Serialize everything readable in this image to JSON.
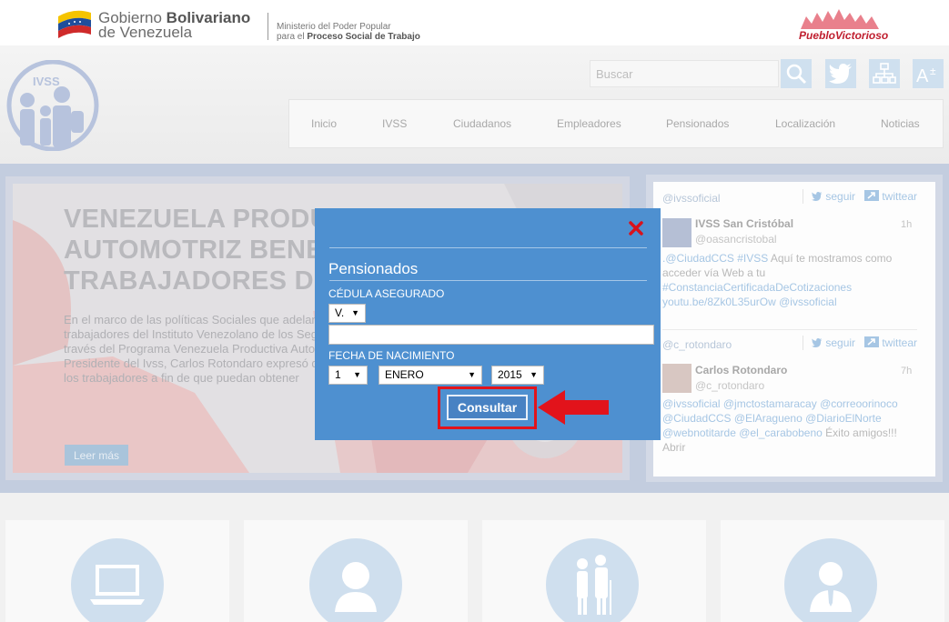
{
  "gov_bar": {
    "gov_name_line1_regular": "Gobierno ",
    "gov_name_line1_bold": "Bolivariano",
    "gov_name_line2": "de Venezuela",
    "ministry_line1": "Ministerio del Poder Popular",
    "ministry_line2_regular": "para el ",
    "ministry_line2_bold": "Proceso Social de Trabajo",
    "pueblo_logo_text": "PuebloVictorioso"
  },
  "header": {
    "search_placeholder": "Buscar",
    "nav": [
      "Inicio",
      "IVSS",
      "Ciudadanos",
      "Empleadores",
      "Pensionados",
      "Localización",
      "Noticias"
    ]
  },
  "slide": {
    "title_lines": [
      "VENEZUELA PRODUCTIVA",
      "AUTOMOTRIZ BENEFICIA",
      "TRABAJADORES DEL IVSS"
    ],
    "text_lines": [
      "En el marco de las políticas Sociales que adelanta el",
      "trabajadores del  Instituto Venezolano de los Seguros",
      "través del Programa Venezuela Productiva Automotriz,",
      "Presidente del Ivss, Carlos Rotondaro expresó que se",
      "los trabajadores a fin de  que puedan obtener"
    ],
    "read_more": "Leer más"
  },
  "twitter": {
    "feeds": [
      {
        "handle": "@ivssoficial",
        "follow": "seguir",
        "twitter_link": "twittear",
        "user": "IVSS San Cristóbal",
        "screen": "@oasancristobal",
        "time": "1h",
        "lines": [
          [
            {
              "t": ".@CiudadCCS #IVSS",
              "l": true
            },
            {
              "t": " Aquí te mostramos como",
              "l": false
            }
          ],
          [
            {
              "t": "acceder vía Web a tu",
              "l": false
            }
          ],
          [
            {
              "t": " #ConstanciaCertificadaDeCotizaciones",
              "l": true
            }
          ],
          [
            {
              "t": " youtu.be/8Zk0L35urOw",
              "l": true
            },
            {
              "t": "  ",
              "l": false
            },
            {
              "t": "@ivssoficial",
              "l": true
            }
          ]
        ]
      },
      {
        "handle": "@c_rotondaro",
        "follow": "seguir",
        "twitter_link": "twittear",
        "user": "Carlos Rotondaro",
        "screen": "@c_rotondaro",
        "time": "7h",
        "lines": [
          [
            {
              "t": "@ivssoficial @jmctostamaracay @correoorinoco",
              "l": true
            }
          ],
          [
            {
              "t": " @CiudadCCS @ElAragueno @DiarioElNorte",
              "l": true
            }
          ],
          [
            {
              "t": " @webnotitarde @el_carabobeno",
              "l": true
            },
            {
              "t": "  Éxito amigos!!!",
              "l": false
            }
          ],
          [
            {
              "t": "Abrir",
              "l": false
            }
          ]
        ]
      }
    ]
  },
  "modal": {
    "title": "Pensionados",
    "cedula_label": "CÉDULA ASEGURADO",
    "nationality": "V.",
    "fecha_label": "FECHA DE NACIMIENTO",
    "day": "1",
    "month": "ENERO",
    "year": "2015",
    "submit": "Consultar"
  },
  "colors": {
    "modal_bg": "#4e90d0",
    "highlight": "#e2131b",
    "brand_light": "#cfdfee"
  }
}
